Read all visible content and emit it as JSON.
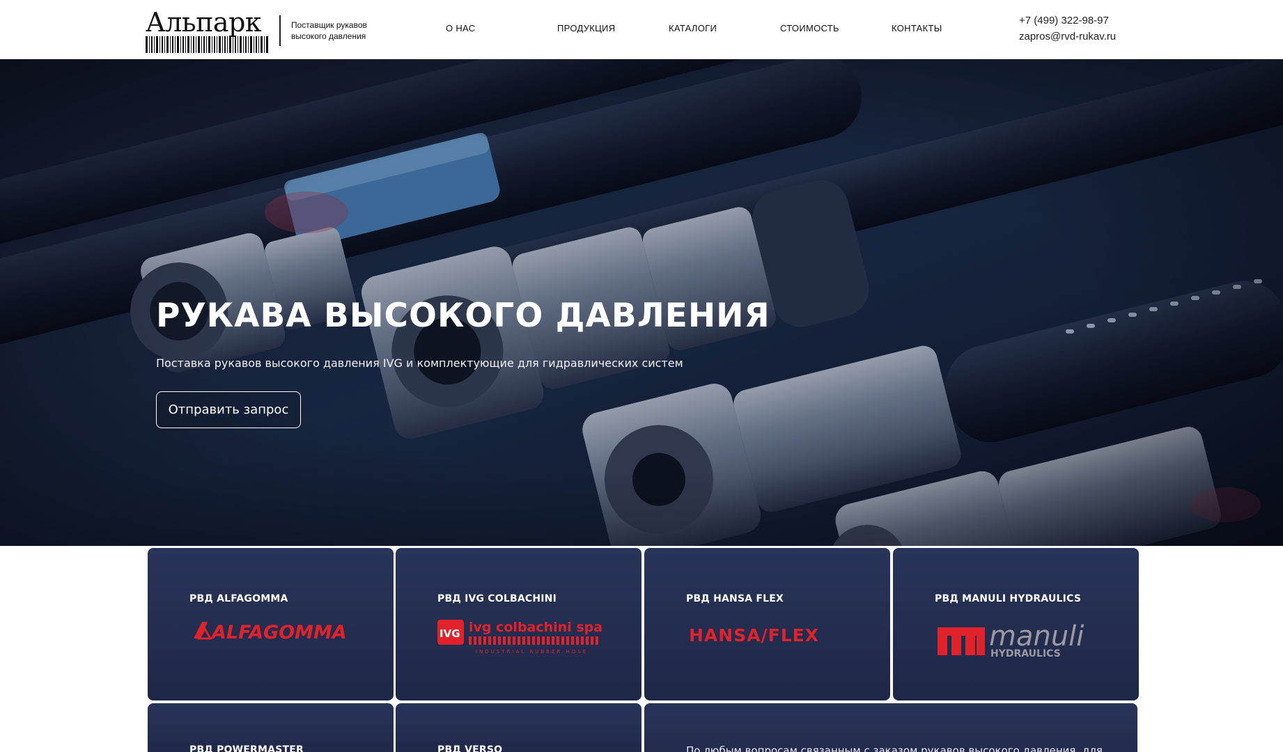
{
  "header": {
    "logo_text": "Альпарк",
    "tagline_line1": "Поставщик рукавов",
    "tagline_line2": "высокого давления",
    "nav": [
      {
        "label": "О НАС"
      },
      {
        "label": "ПРОДУКЦИЯ"
      },
      {
        "label": "КАТАЛОГИ"
      },
      {
        "label": "СТОИМОСТЬ"
      },
      {
        "label": "КОНТАКТЫ"
      }
    ],
    "phone": "+7 (499) 322-98-97",
    "email": "zapros@rvd-rukav.ru"
  },
  "hero": {
    "title": "РУКАВА ВЫСОКОГО ДАВЛЕНИЯ",
    "subtitle": "Поставка рукавов высокого давления IVG и комплектующие для гидравлических систем",
    "button_label": "Отправить запрос"
  },
  "cards": [
    {
      "title": "РВД ALFAGOMMA",
      "logo_text": "ALFAGOMMA",
      "logo_icon": "alfagomma-logo"
    },
    {
      "title": "РВД IVG COLBACHINI",
      "logo_text": "ivg colbachini spa",
      "logo_badge": "IVG",
      "logo_caption": "INDUSTRIAL RUBBER HOSE",
      "logo_icon": "ivg-logo"
    },
    {
      "title": "РВД HANSA FLEX",
      "logo_text": "HANSA/FLEX",
      "logo_icon": "hansaflex-logo"
    },
    {
      "title": "РВД MANULI HYDRAULICS",
      "logo_text": "manuli",
      "logo_caption": "HYDRAULICS",
      "logo_icon": "manuli-logo"
    },
    {
      "title": "РВД POWERMASTER"
    },
    {
      "title": "РВД VERSO"
    }
  ],
  "info_card": {
    "text": "По любым вопросам связанным с заказом рукавов высокого давления, для"
  },
  "colors": {
    "card_bg": "#252f53",
    "brand_red": "#e0222b",
    "manuli_grey": "#9a9aa0"
  }
}
